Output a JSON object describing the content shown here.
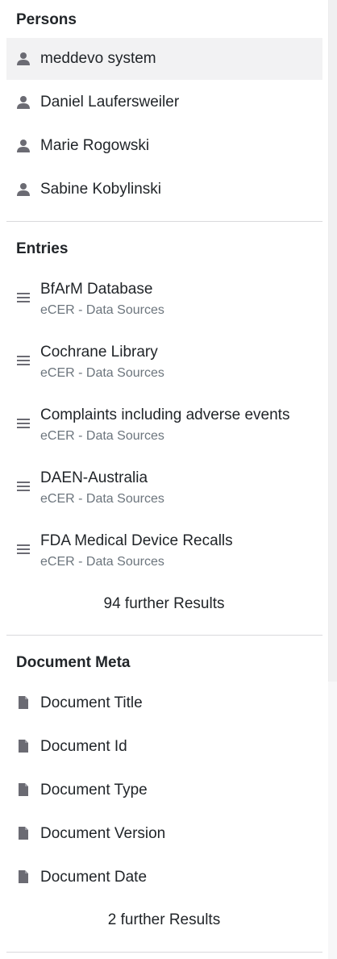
{
  "persons": {
    "title": "Persons",
    "items": [
      {
        "label": "meddevo system",
        "icon": "person-icon"
      },
      {
        "label": "Daniel Laufersweiler",
        "icon": "person-icon"
      },
      {
        "label": "Marie Rogowski",
        "icon": "person-icon"
      },
      {
        "label": "Sabine Kobylinski",
        "icon": "person-icon"
      }
    ]
  },
  "entries": {
    "title": "Entries",
    "items": [
      {
        "label": "BfArM Database",
        "sub": "eCER - Data Sources",
        "icon": "list-icon"
      },
      {
        "label": "Cochrane Library",
        "sub": "eCER - Data Sources",
        "icon": "list-icon"
      },
      {
        "label": "Complaints including adverse events",
        "sub": "eCER - Data Sources",
        "icon": "list-icon"
      },
      {
        "label": "DAEN-Australia",
        "sub": "eCER - Data Sources",
        "icon": "list-icon"
      },
      {
        "label": "FDA Medical Device Recalls",
        "sub": "eCER - Data Sources",
        "icon": "list-icon"
      }
    ],
    "more": "94 further Results"
  },
  "document_meta": {
    "title": "Document Meta",
    "items": [
      {
        "label": "Document Title",
        "icon": "document-icon"
      },
      {
        "label": "Document Id",
        "icon": "document-icon"
      },
      {
        "label": "Document Type",
        "icon": "document-icon"
      },
      {
        "label": "Document Version",
        "icon": "document-icon"
      },
      {
        "label": "Document Date",
        "icon": "document-icon"
      }
    ],
    "more": "2 further Results"
  },
  "colors": {
    "icon": "#6b6b73",
    "highlight": "#f2f2f3",
    "subtext": "#6c757d",
    "divider": "#d9d9dc"
  }
}
